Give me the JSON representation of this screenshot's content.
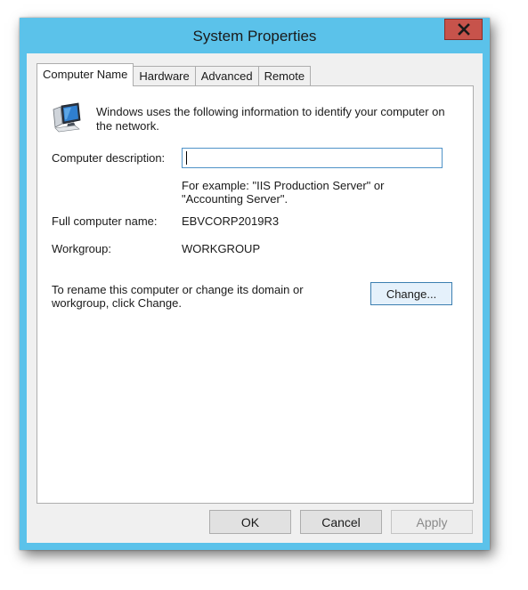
{
  "window": {
    "title": "System Properties",
    "accent_color": "#5bc2ea",
    "close_color": "#c7534b"
  },
  "tabs": [
    {
      "label": "Computer Name",
      "active": true
    },
    {
      "label": "Hardware",
      "active": false
    },
    {
      "label": "Advanced",
      "active": false
    },
    {
      "label": "Remote",
      "active": false
    }
  ],
  "computer_name": {
    "icon": "computer-icon",
    "intro": "Windows uses the following information to identify your computer on the network.",
    "description_label": "Computer description:",
    "description_value": "",
    "hint": "For example: \"IIS Production Server\" or \"Accounting Server\".",
    "full_name_label": "Full computer name:",
    "full_name_value": "EBVCORP2019R3",
    "workgroup_label": "Workgroup:",
    "workgroup_value": "WORKGROUP",
    "rename_text": "To rename this computer or change its domain or workgroup, click Change.",
    "change_label": "Change..."
  },
  "buttons": {
    "ok": "OK",
    "cancel": "Cancel",
    "apply": "Apply"
  }
}
